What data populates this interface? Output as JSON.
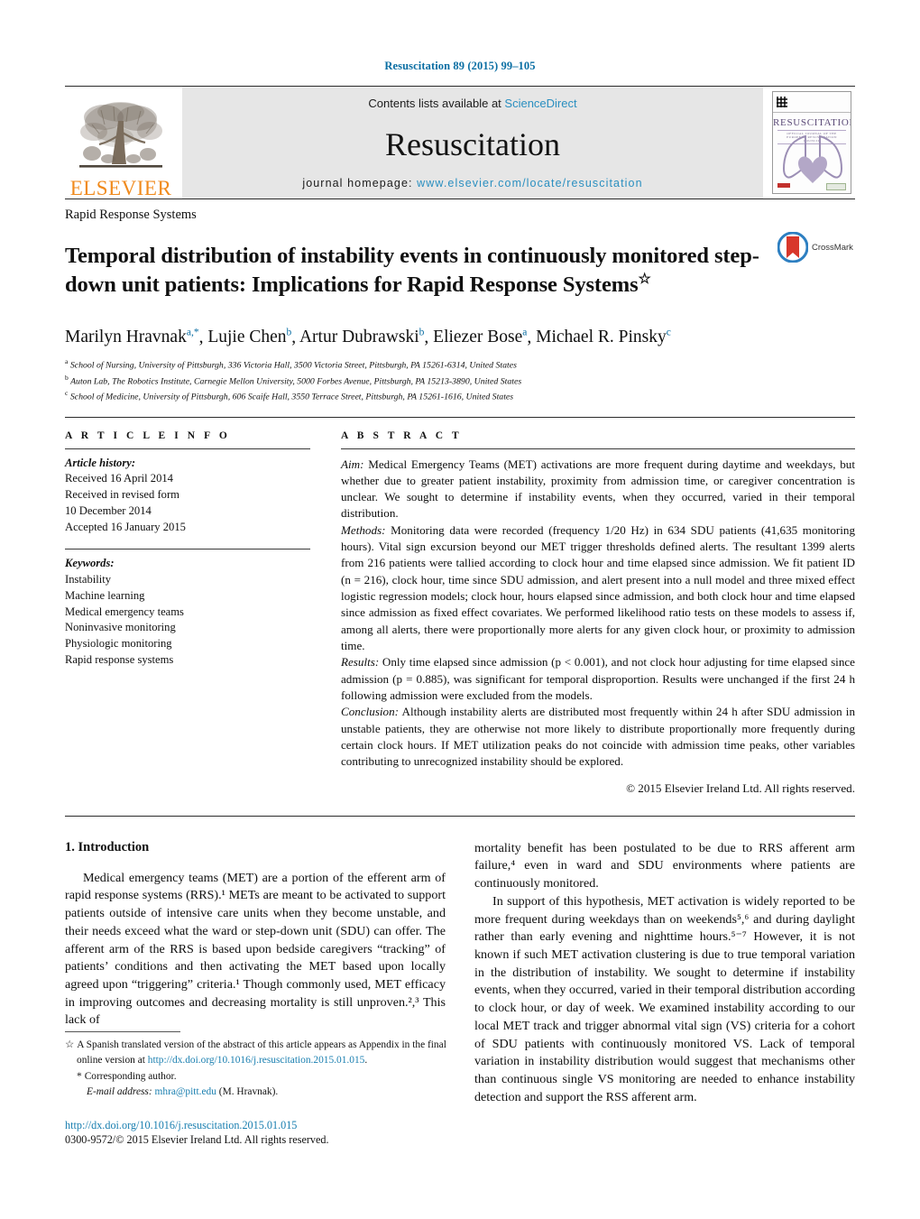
{
  "running_head": "Resuscitation 89 (2015) 99–105",
  "masthead": {
    "publisher_name": "ELSEVIER",
    "contents_prefix": "Contents lists available at ",
    "contents_link": "ScienceDirect",
    "journal_name": "Resuscitation",
    "homepage_prefix": "journal homepage: ",
    "homepage_url": "www.elsevier.com/locate/resuscitation",
    "cover_title": "RESUSCITATION",
    "cover_subtitle": "OFFICIAL JOURNAL OF THE EUROPEAN RESUSCITATION COUNCIL"
  },
  "article": {
    "section_kicker": "Rapid Response Systems",
    "title": "Temporal distribution of instability events in continuously monitored step-down unit patients: Implications for Rapid Response Systems",
    "title_marker": "☆",
    "crossmark_label": "CrossMark",
    "authors": [
      {
        "name": "Marilyn Hravnak",
        "sup": "a,*"
      },
      {
        "name": "Lujie Chen",
        "sup": "b"
      },
      {
        "name": "Artur Dubrawski",
        "sup": "b"
      },
      {
        "name": "Eliezer Bose",
        "sup": "a"
      },
      {
        "name": "Michael R. Pinsky",
        "sup": "c"
      }
    ],
    "affiliations": [
      {
        "sup": "a",
        "text": "School of Nursing, University of Pittsburgh, 336 Victoria Hall, 3500 Victoria Street, Pittsburgh, PA 15261-6314, United States"
      },
      {
        "sup": "b",
        "text": "Auton Lab, The Robotics Institute, Carnegie Mellon University, 5000 Forbes Avenue, Pittsburgh, PA 15213-3890, United States"
      },
      {
        "sup": "c",
        "text": "School of Medicine, University of Pittsburgh, 606 Scaife Hall, 3550 Terrace Street, Pittsburgh, PA 15261-1616, United States"
      }
    ]
  },
  "article_info": {
    "heading": "A R T I C L E   I N F O",
    "history_label": "Article history:",
    "history": [
      "Received 16 April 2014",
      "Received in revised form",
      "10 December 2014",
      "Accepted 16 January 2015"
    ],
    "keywords_label": "Keywords:",
    "keywords": [
      "Instability",
      "Machine learning",
      "Medical emergency teams",
      "Noninvasive monitoring",
      "Physiologic monitoring",
      "Rapid response systems"
    ]
  },
  "abstract": {
    "heading": "A B S T R A C T",
    "sections": [
      {
        "label": "Aim:",
        "text": " Medical Emergency Teams (MET) activations are more frequent during daytime and weekdays, but whether due to greater patient instability, proximity from admission time, or caregiver concentration is unclear. We sought to determine if instability events, when they occurred, varied in their temporal distribution."
      },
      {
        "label": "Methods:",
        "text": " Monitoring data were recorded (frequency 1/20 Hz) in 634 SDU patients (41,635 monitoring hours). Vital sign excursion beyond our MET trigger thresholds defined alerts. The resultant 1399 alerts from 216 patients were tallied according to clock hour and time elapsed since admission. We fit patient ID (n = 216), clock hour, time since SDU admission, and alert present into a null model and three mixed effect logistic regression models; clock hour, hours elapsed since admission, and both clock hour and time elapsed since admission as fixed effect covariates. We performed likelihood ratio tests on these models to assess if, among all alerts, there were proportionally more alerts for any given clock hour, or proximity to admission time."
      },
      {
        "label": "Results:",
        "text": " Only time elapsed since admission (p < 0.001), and not clock hour adjusting for time elapsed since admission (p = 0.885), was significant for temporal disproportion. Results were unchanged if the first 24 h following admission were excluded from the models."
      },
      {
        "label": "Conclusion:",
        "text": " Although instability alerts are distributed most frequently within 24 h after SDU admission in unstable patients, they are otherwise not more likely to distribute proportionally more frequently during certain clock hours. If MET utilization peaks do not coincide with admission time peaks, other variables contributing to unrecognized instability should be explored."
      }
    ],
    "copyright": "© 2015 Elsevier Ireland Ltd. All rights reserved."
  },
  "introduction": {
    "heading": "1.  Introduction",
    "left_paragraphs": [
      "Medical emergency teams (MET) are a portion of the efferent arm of rapid response systems (RRS).¹ METs are meant to be activated to support patients outside of intensive care units when they become unstable, and their needs exceed what the ward or step-down unit (SDU) can offer. The afferent arm of the RRS is based upon bedside caregivers “tracking” of patients’ conditions and then activating the MET based upon locally agreed upon “triggering” criteria.¹ Though commonly used, MET efficacy in improving outcomes and decreasing mortality is still unproven.²,³ This lack of"
    ],
    "right_paragraphs": [
      "mortality benefit has been postulated to be due to RRS afferent arm failure,⁴ even in ward and SDU environments where patients are continuously monitored.",
      "In support of this hypothesis, MET activation is widely reported to be more frequent during weekdays than on weekends⁵,⁶ and during daylight rather than early evening and nighttime hours.⁵⁻⁷ However, it is not known if such MET activation clustering is due to true temporal variation in the distribution of instability. We sought to determine if instability events, when they occurred, varied in their temporal distribution according to clock hour, or day of week. We examined instability according to our local MET track and trigger abnormal vital sign (VS) criteria for a cohort of SDU patients with continuously monitored VS. Lack of temporal variation in instability distribution would suggest that mechanisms other than continuous single VS monitoring are needed to enhance instability detection and support the RSS afferent arm."
    ]
  },
  "footnotes": {
    "star_symbol": "☆",
    "appendix_note_part1": "A Spanish translated version of the abstract of this article appears as Appendix in the final online version at ",
    "appendix_note_link": "http://dx.doi.org/10.1016/j.resuscitation.2015.01.015",
    "appendix_note_end": ".",
    "corresponding_symbol": "*",
    "corresponding_label": "Corresponding author.",
    "email_label": "E-mail address:",
    "email_link": "mhra@pitt.edu",
    "email_owner": "(M. Hravnak).",
    "doi": "http://dx.doi.org/10.1016/j.resuscitation.2015.01.015",
    "issn_line": "0300-9572/© 2015 Elsevier Ireland Ltd. All rights reserved."
  },
  "colors": {
    "link_blue": "#1a7fb0",
    "running_head_blue": "#0a6ea3",
    "elsevier_orange": "#f08a1c",
    "masthead_grey": "#e6e6e6",
    "cover_purple": "#5b4a77"
  }
}
